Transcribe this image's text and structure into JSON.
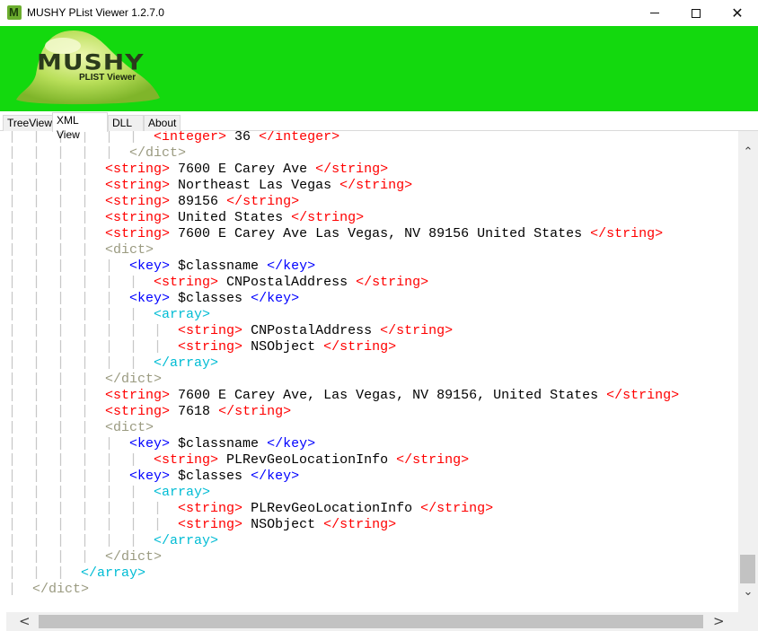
{
  "window": {
    "title": "MUSHY PList Viewer 1.2.7.0",
    "app_icon_letter": "M",
    "minimize_glyph": "",
    "maximize_glyph": "",
    "close_glyph": "✕"
  },
  "banner": {
    "logo_title": "MUSHY",
    "logo_subtitle": "PLIST Viewer",
    "background_color": "#13d90e"
  },
  "tabs": [
    {
      "label": "TreeView",
      "active": false
    },
    {
      "label": "XML View",
      "active": true
    },
    {
      "label": "DLL",
      "active": false
    },
    {
      "label": "About",
      "active": false
    }
  ],
  "xml_view": {
    "colors": {
      "string_tag": "#ff0000",
      "key_tag": "#0000ff",
      "array_tag": "#00bcd4",
      "dict_tag": "#9a9a80",
      "guide": "#c8c8c8",
      "text": "#000000"
    },
    "lines": [
      {
        "guide": " |  |  |  |  |  |  ",
        "segments": [
          {
            "cls": "r",
            "text": "<integer> "
          },
          {
            "cls": "t",
            "text": "36 "
          },
          {
            "cls": "r",
            "text": "</integer>"
          }
        ]
      },
      {
        "guide": " |  |  |  |  |  ",
        "segments": [
          {
            "cls": "o",
            "text": "</dict>"
          }
        ]
      },
      {
        "guide": " |  |  |  |  ",
        "segments": [
          {
            "cls": "r",
            "text": "<string> "
          },
          {
            "cls": "t",
            "text": "7600 E Carey Ave "
          },
          {
            "cls": "r",
            "text": "</string>"
          }
        ]
      },
      {
        "guide": " |  |  |  |  ",
        "segments": [
          {
            "cls": "r",
            "text": "<string> "
          },
          {
            "cls": "t",
            "text": "Northeast Las Vegas "
          },
          {
            "cls": "r",
            "text": "</string>"
          }
        ]
      },
      {
        "guide": " |  |  |  |  ",
        "segments": [
          {
            "cls": "r",
            "text": "<string> "
          },
          {
            "cls": "t",
            "text": "89156 "
          },
          {
            "cls": "r",
            "text": "</string>"
          }
        ]
      },
      {
        "guide": " |  |  |  |  ",
        "segments": [
          {
            "cls": "r",
            "text": "<string> "
          },
          {
            "cls": "t",
            "text": "United States "
          },
          {
            "cls": "r",
            "text": "</string>"
          }
        ]
      },
      {
        "guide": " |  |  |  |  ",
        "segments": [
          {
            "cls": "r",
            "text": "<string> "
          },
          {
            "cls": "t",
            "text": "7600 E Carey Ave Las Vegas, NV 89156 United States "
          },
          {
            "cls": "r",
            "text": "</string>"
          }
        ]
      },
      {
        "guide": " |  |  |  |  ",
        "segments": [
          {
            "cls": "o",
            "text": "<dict>"
          }
        ]
      },
      {
        "guide": " |  |  |  |  |  ",
        "segments": [
          {
            "cls": "b",
            "text": "<key> "
          },
          {
            "cls": "t",
            "text": "$classname "
          },
          {
            "cls": "b",
            "text": "</key>"
          }
        ]
      },
      {
        "guide": " |  |  |  |  |  |  ",
        "segments": [
          {
            "cls": "r",
            "text": "<string> "
          },
          {
            "cls": "t",
            "text": "CNPostalAddress "
          },
          {
            "cls": "r",
            "text": "</string>"
          }
        ]
      },
      {
        "guide": " |  |  |  |  |  ",
        "segments": [
          {
            "cls": "b",
            "text": "<key> "
          },
          {
            "cls": "t",
            "text": "$classes "
          },
          {
            "cls": "b",
            "text": "</key>"
          }
        ]
      },
      {
        "guide": " |  |  |  |  |  |  ",
        "segments": [
          {
            "cls": "c",
            "text": "<array>"
          }
        ]
      },
      {
        "guide": " |  |  |  |  |  |  |  ",
        "segments": [
          {
            "cls": "r",
            "text": "<string> "
          },
          {
            "cls": "t",
            "text": "CNPostalAddress "
          },
          {
            "cls": "r",
            "text": "</string>"
          }
        ]
      },
      {
        "guide": " |  |  |  |  |  |  |  ",
        "segments": [
          {
            "cls": "r",
            "text": "<string> "
          },
          {
            "cls": "t",
            "text": "NSObject "
          },
          {
            "cls": "r",
            "text": "</string>"
          }
        ]
      },
      {
        "guide": " |  |  |  |  |  |  ",
        "segments": [
          {
            "cls": "c",
            "text": "</array>"
          }
        ]
      },
      {
        "guide": " |  |  |  |  ",
        "segments": [
          {
            "cls": "o",
            "text": "</dict>"
          }
        ]
      },
      {
        "guide": " |  |  |  |  ",
        "segments": [
          {
            "cls": "r",
            "text": "<string> "
          },
          {
            "cls": "t",
            "text": "7600 E Carey Ave, Las Vegas, NV 89156, United States "
          },
          {
            "cls": "r",
            "text": "</string>"
          }
        ]
      },
      {
        "guide": " |  |  |  |  ",
        "segments": [
          {
            "cls": "r",
            "text": "<string> "
          },
          {
            "cls": "t",
            "text": "7618 "
          },
          {
            "cls": "r",
            "text": "</string>"
          }
        ]
      },
      {
        "guide": " |  |  |  |  ",
        "segments": [
          {
            "cls": "o",
            "text": "<dict>"
          }
        ]
      },
      {
        "guide": " |  |  |  |  |  ",
        "segments": [
          {
            "cls": "b",
            "text": "<key> "
          },
          {
            "cls": "t",
            "text": "$classname "
          },
          {
            "cls": "b",
            "text": "</key>"
          }
        ]
      },
      {
        "guide": " |  |  |  |  |  |  ",
        "segments": [
          {
            "cls": "r",
            "text": "<string> "
          },
          {
            "cls": "t",
            "text": "PLRevGeoLocationInfo "
          },
          {
            "cls": "r",
            "text": "</string>"
          }
        ]
      },
      {
        "guide": " |  |  |  |  |  ",
        "segments": [
          {
            "cls": "b",
            "text": "<key> "
          },
          {
            "cls": "t",
            "text": "$classes "
          },
          {
            "cls": "b",
            "text": "</key>"
          }
        ]
      },
      {
        "guide": " |  |  |  |  |  |  ",
        "segments": [
          {
            "cls": "c",
            "text": "<array>"
          }
        ]
      },
      {
        "guide": " |  |  |  |  |  |  |  ",
        "segments": [
          {
            "cls": "r",
            "text": "<string> "
          },
          {
            "cls": "t",
            "text": "PLRevGeoLocationInfo "
          },
          {
            "cls": "r",
            "text": "</string>"
          }
        ]
      },
      {
        "guide": " |  |  |  |  |  |  |  ",
        "segments": [
          {
            "cls": "r",
            "text": "<string> "
          },
          {
            "cls": "t",
            "text": "NSObject "
          },
          {
            "cls": "r",
            "text": "</string>"
          }
        ]
      },
      {
        "guide": " |  |  |  |  |  |  ",
        "segments": [
          {
            "cls": "c",
            "text": "</array>"
          }
        ]
      },
      {
        "guide": " |  |  |  |  ",
        "segments": [
          {
            "cls": "o",
            "text": "</dict>"
          }
        ]
      },
      {
        "guide": " |  |  |  ",
        "segments": [
          {
            "cls": "c",
            "text": "</array>"
          }
        ]
      },
      {
        "guide": " |  ",
        "segments": [
          {
            "cls": "o",
            "text": "</dict>"
          }
        ]
      }
    ]
  },
  "scrollbars": {
    "vertical_up_glyph": "⌃",
    "vertical_down_glyph": "⌄",
    "horizontal_left_glyph": "<",
    "horizontal_right_glyph": ">",
    "vertical_position": 0.96
  }
}
